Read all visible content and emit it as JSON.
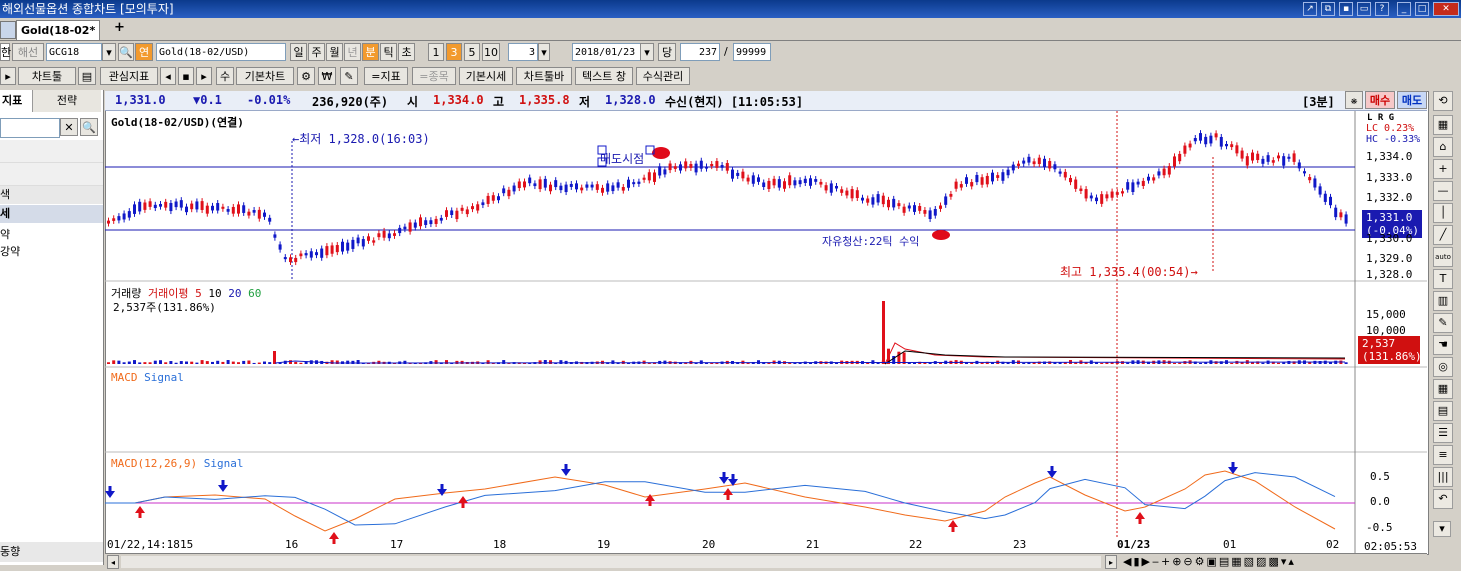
{
  "window": {
    "title": "해외선물옵션 종합차트 [모의투자]"
  },
  "tab": {
    "label": "Gold(18-02*",
    "add": "+"
  },
  "toolbar1": {
    "code": "GCG18",
    "name": "Gold(18-02/USD)",
    "continuous": "연",
    "periods": [
      "일",
      "주",
      "월",
      "년",
      "분",
      "틱",
      "초"
    ],
    "active_period": "분",
    "intervals": [
      "1",
      "3",
      "5",
      "10"
    ],
    "active_interval": "3",
    "count": "3",
    "date": "2018/01/23",
    "dang": "당",
    "display_count": "237",
    "max_count": "99999",
    "futures_label": "해선"
  },
  "toolbar2": {
    "chart_tool": "차트툴",
    "interest": "관심지표",
    "su": "수",
    "basic_chart": "기본차트",
    "indicator": "=지표",
    "stock": "=종목",
    "basic_quote": "기본시세",
    "chart_toolbar": "차트툴바",
    "text_window": "텍스트 창",
    "formula": "수식관리"
  },
  "left_panel": {
    "tabs": [
      "지표",
      "전략"
    ],
    "items": [
      "색",
      "세",
      "약",
      "강약"
    ],
    "bottom": "동향"
  },
  "infobar": {
    "price": "1,331.0",
    "change": "▼0.1",
    "pct": "-0.01%",
    "volume": "236,920(주)",
    "open_label": "시",
    "open": "1,334.0",
    "high_label": "고",
    "high": "1,335.8",
    "low_label": "저",
    "low": "1,328.0",
    "status": "수신(현지) [11:05:53]",
    "interval": "[3분]",
    "buy": "매수",
    "sell": "매도"
  },
  "price_pane": {
    "title": "Gold(18-02/USD)(연결)",
    "low_note": "←최저 1,328.0(16:03)",
    "high_note": "최고 1,335.4(00:54)→",
    "sell_signal": "매도시점",
    "exit_note": "자유청산:22틱 수익",
    "legend": [
      "LC 0.23%",
      "HC -0.33%"
    ],
    "lrg": "L R G",
    "current": "1,331.0",
    "current_pct": "(-0.04%)",
    "y_ticks": [
      "1,334.0",
      "1,333.0",
      "1,332.0",
      "1,330.0",
      "1,329.0",
      "1,328.0"
    ]
  },
  "volume_pane": {
    "title_a": "거래량",
    "title_b": "거래이평",
    "ma": [
      "5",
      "10",
      "20",
      "60"
    ],
    "value": "2,537주(131.86%)",
    "y_ticks": [
      "15,000",
      "10,000"
    ],
    "current": "2,537",
    "current_pct": "(131.86%)"
  },
  "macd_signal_pane": {
    "title_a": "MACD",
    "title_b": "Signal"
  },
  "macd_pane": {
    "title_a": "MACD(12,26,9)",
    "title_b": "Signal",
    "y_ticks": [
      "0.5",
      "0.0",
      "-0.5"
    ]
  },
  "x_axis": {
    "labels": [
      "01/22,14:18",
      "15",
      "16",
      "17",
      "18",
      "19",
      "20",
      "21",
      "22",
      "23",
      "01/23",
      "01",
      "02"
    ],
    "time": "02:05:53"
  },
  "colors": {
    "up": "#e0101a",
    "down": "#1018c8",
    "macd": "#f06a1a",
    "signal": "#2a6fd8",
    "zero": "#c832c8"
  }
}
